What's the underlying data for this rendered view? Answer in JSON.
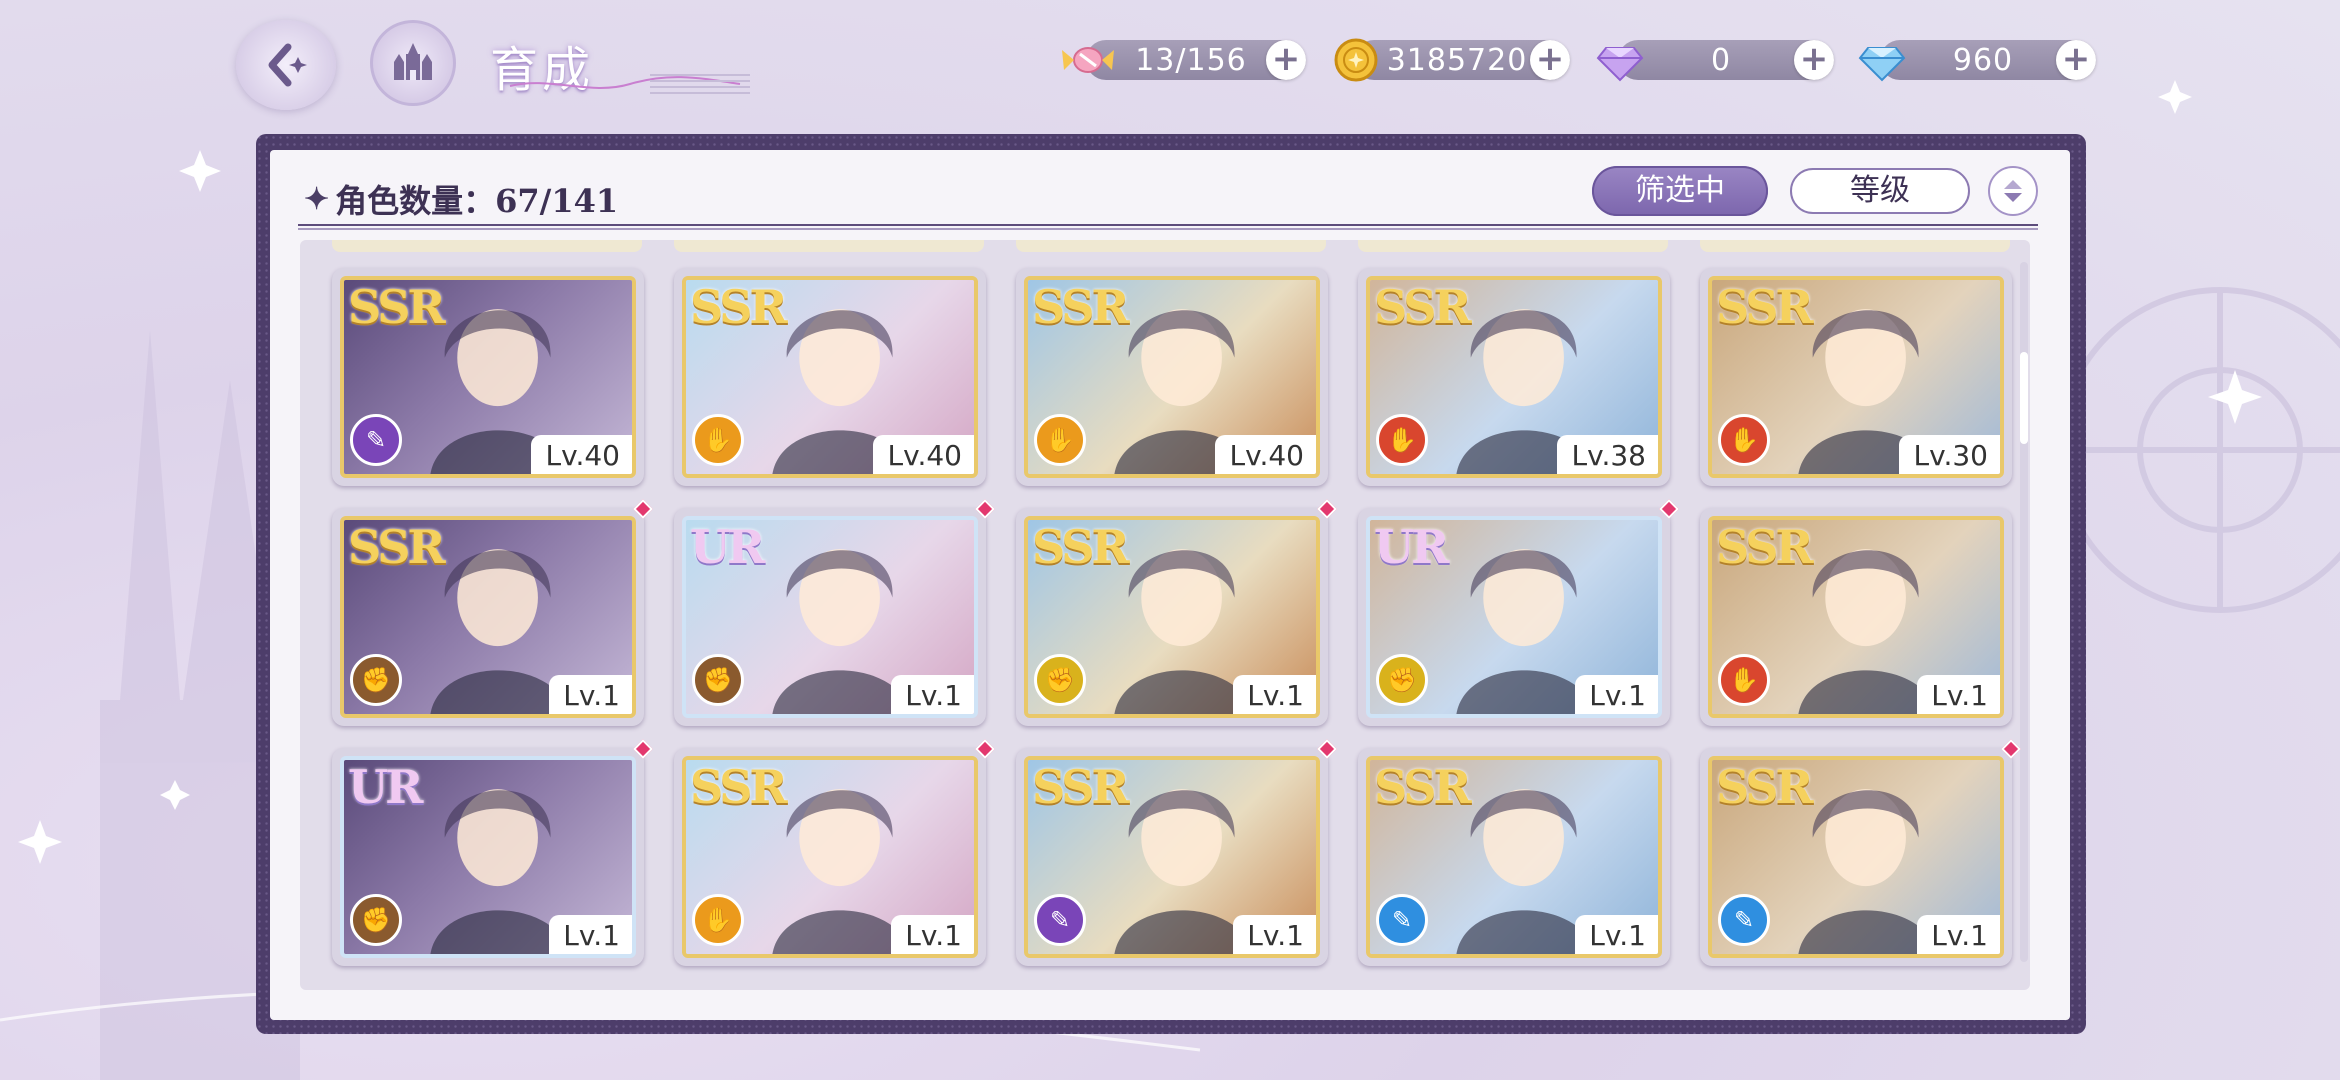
{
  "header": {
    "title": "育成",
    "currencies": [
      {
        "icon": "candy-icon",
        "value": "13/156"
      },
      {
        "icon": "gold-coin-icon",
        "value": "3185720"
      },
      {
        "icon": "pink-gem-icon",
        "value": "0"
      },
      {
        "icon": "blue-diamond-icon",
        "value": "960"
      }
    ]
  },
  "panel": {
    "count_label": "角色数量：67/141",
    "filter_label": "筛选中",
    "sort_label": "等级"
  },
  "cards": [
    {
      "rarity": "SSR",
      "level": "Lv.40",
      "role": "purple",
      "new": false
    },
    {
      "rarity": "SSR",
      "level": "Lv.40",
      "role": "orange",
      "new": false
    },
    {
      "rarity": "SSR",
      "level": "Lv.40",
      "role": "orange",
      "new": false
    },
    {
      "rarity": "SSR",
      "level": "Lv.38",
      "role": "red",
      "new": false
    },
    {
      "rarity": "SSR",
      "level": "Lv.30",
      "role": "red",
      "new": false
    },
    {
      "rarity": "SSR",
      "level": "Lv.1",
      "role": "brown",
      "new": true
    },
    {
      "rarity": "UR",
      "level": "Lv.1",
      "role": "brown",
      "new": true
    },
    {
      "rarity": "SSR",
      "level": "Lv.1",
      "role": "yellow",
      "new": true
    },
    {
      "rarity": "UR",
      "level": "Lv.1",
      "role": "yellow",
      "new": true
    },
    {
      "rarity": "SSR",
      "level": "Lv.1",
      "role": "red",
      "new": false
    },
    {
      "rarity": "UR",
      "level": "Lv.1",
      "role": "brown",
      "new": true
    },
    {
      "rarity": "SSR",
      "level": "Lv.1",
      "role": "orange",
      "new": true
    },
    {
      "rarity": "SSR",
      "level": "Lv.1",
      "role": "purple",
      "new": true
    },
    {
      "rarity": "SSR",
      "level": "Lv.1",
      "role": "blue",
      "new": false
    },
    {
      "rarity": "SSR",
      "level": "Lv.1",
      "role": "blue",
      "new": true
    }
  ],
  "colors": {
    "purple": "#7a45b8",
    "orange": "#eb9a1c",
    "red": "#d9462e",
    "brown": "#8a5a2e",
    "yellow": "#d9b21c",
    "blue": "#2f8fe0",
    "panel_frame": "#4d3d6a",
    "filter_active": "#8a75bb"
  }
}
